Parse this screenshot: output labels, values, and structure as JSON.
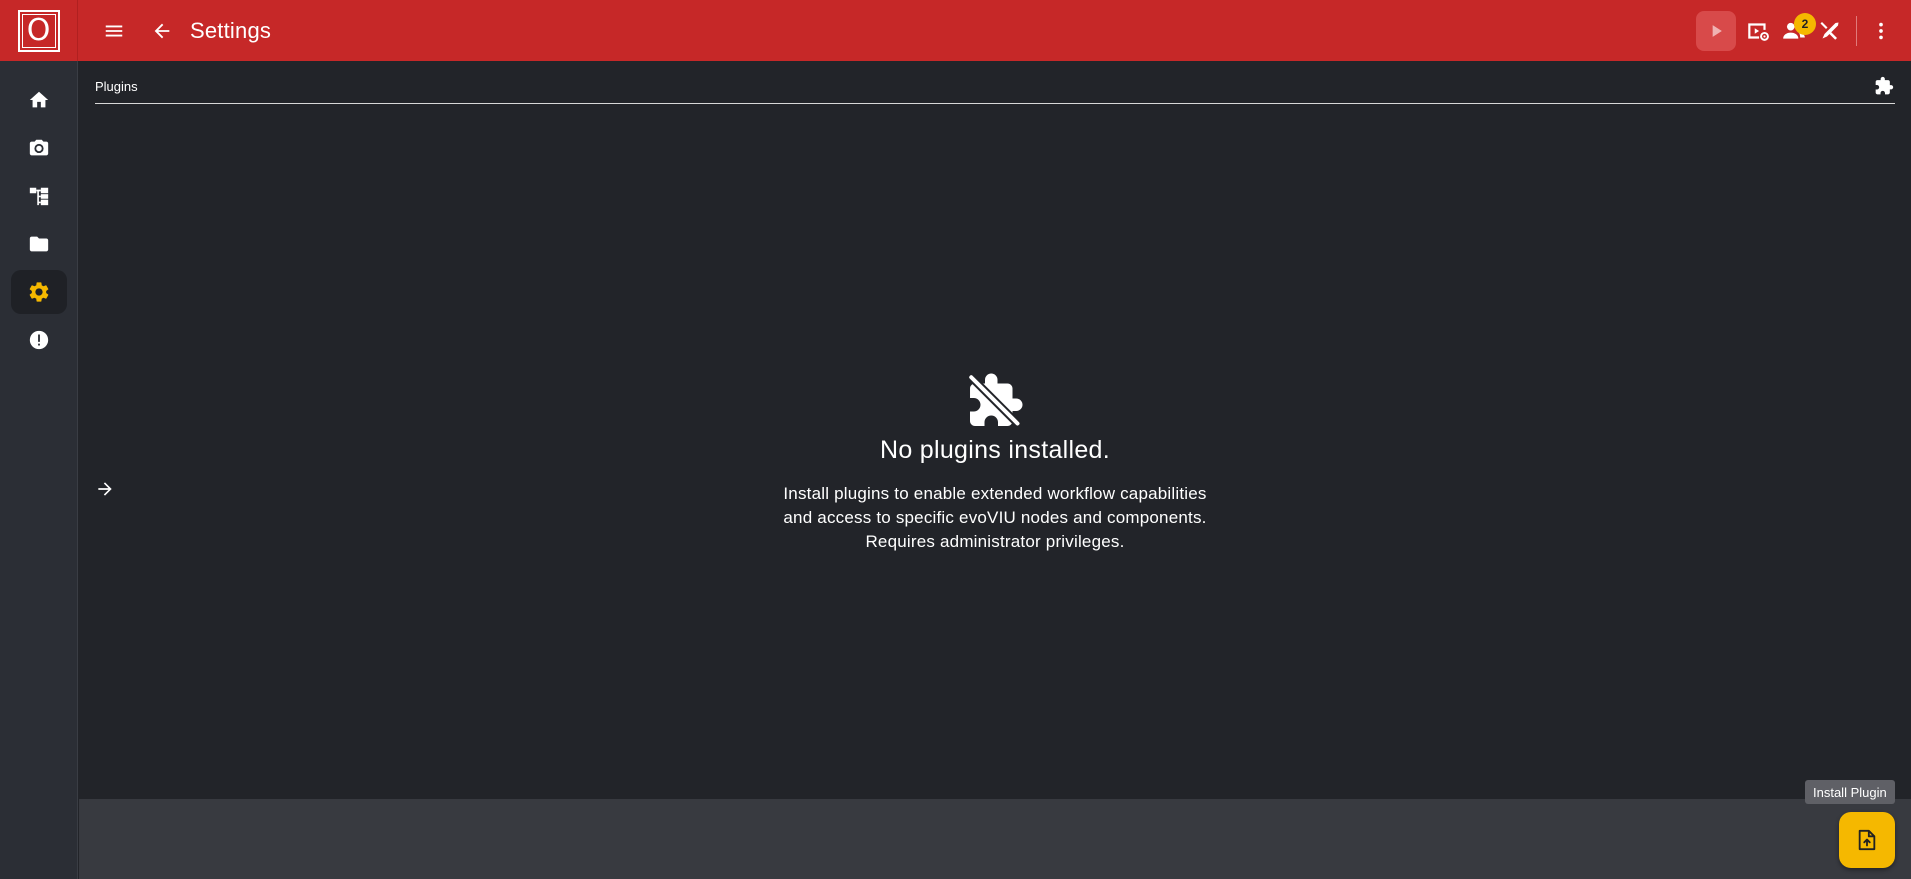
{
  "app": {
    "logo_letter": "O",
    "title": "Settings"
  },
  "topbar": {
    "badge_count": "2",
    "icons": [
      "menu-icon",
      "back-arrow-icon",
      "play-icon",
      "video-settings-icon",
      "users-icon",
      "tools-icon",
      "more-vert-icon"
    ]
  },
  "siderail": {
    "items": [
      "home-icon",
      "camera-icon",
      "workflow-icon",
      "folder-icon",
      "gear-icon",
      "alert-icon"
    ],
    "active": "gear-icon"
  },
  "section": {
    "title": "Plugins"
  },
  "empty_state": {
    "title": "No plugins installed.",
    "line1": "Install plugins to enable extended workflow capabilities",
    "line2": "and access to specific evoVIU nodes and components.",
    "line3": "Requires administrator privileges."
  },
  "fab": {
    "tooltip": "Install Plugin"
  },
  "colors": {
    "topbar": "#c62828",
    "background": "#222429",
    "rail": "#2b2e35",
    "accent": "#f5b800"
  }
}
